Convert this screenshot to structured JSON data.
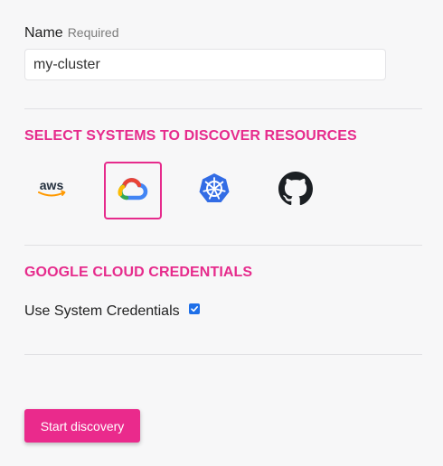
{
  "form": {
    "name_label": "Name",
    "required_label": "Required",
    "name_value": "my-cluster"
  },
  "systems_section": {
    "title": "SELECT SYSTEMS TO DISCOVER RESOURCES",
    "systems": [
      {
        "id": "aws",
        "icon": "aws-icon",
        "selected": false
      },
      {
        "id": "gcp",
        "icon": "google-cloud-icon",
        "selected": true
      },
      {
        "id": "kubernetes",
        "icon": "kubernetes-icon",
        "selected": false
      },
      {
        "id": "github",
        "icon": "github-icon",
        "selected": false
      }
    ]
  },
  "credentials_section": {
    "title": "GOOGLE CLOUD CREDENTIALS",
    "use_system_label": "Use System Credentials",
    "use_system_checked": true
  },
  "actions": {
    "start_label": "Start discovery"
  },
  "colors": {
    "accent": "#e62b8c",
    "button": "#ea2a8c",
    "checkbox": "#1e6fe8"
  }
}
